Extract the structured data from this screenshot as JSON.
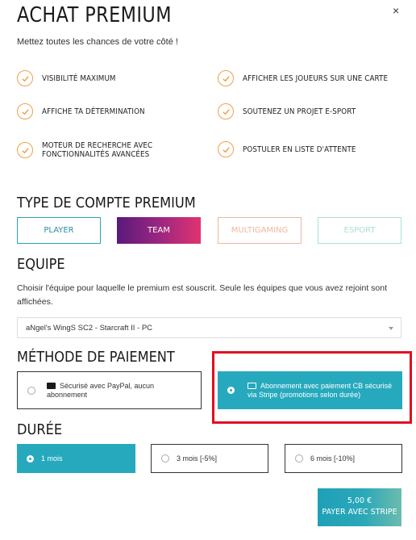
{
  "header": {
    "title": "ACHAT PREMIUM",
    "close_label": "×",
    "subtitle": "Mettez toutes les chances de votre côté !"
  },
  "features": {
    "f1": "VISIBILITÉ MAXIMUM",
    "f2": "AFFICHER LES JOUEURS SUR UNE CARTE",
    "f3": "AFFICHE TA DÉTERMINATION",
    "f4": "SOUTENEZ UN PROJET E-SPORT",
    "f5_line1": "MOTEUR DE RECHERCHE AVEC",
    "f5_line2": "FONCTIONNALITÉS AVANCÉES",
    "f6": "POSTULER EN LISTE D'ATTENTE"
  },
  "account_type": {
    "title": "TYPE DE COMPTE PREMIUM",
    "player": "PLAYER",
    "team": "TEAM",
    "multigaming": "MULTIGAMING",
    "esport": "ESPORT",
    "selected": "TEAM"
  },
  "team": {
    "title": "EQUIPE",
    "description": "Choisir l'équipe pour laquelle le premium est souscrit. Seule les équipes que vous avez rejoint sont affichées.",
    "selected_value": "aNgel's WingS SC2 - Starcraft II - PC"
  },
  "payment": {
    "title": "MÉTHODE DE PAIEMENT",
    "paypal_line1": "Sécurisé avec PayPal, aucun",
    "paypal_line2": "abonnement",
    "stripe_line1": "Abonnement avec paiement CB sécurisé",
    "stripe_line2": "via Stripe (promotions selon durée)",
    "selected": "stripe"
  },
  "duration": {
    "title": "DURÉE",
    "opt1": "1 mois",
    "opt3": "3 mois [-5%]",
    "opt6": "6 mois [-10%]",
    "selected": "1 mois"
  },
  "checkout": {
    "price": "5,00 €",
    "button_label": "PAYER AVEC STRIPE"
  },
  "colors": {
    "accent": "#26a9bd",
    "check": "#f0a14a",
    "highlight": "#e01020"
  }
}
